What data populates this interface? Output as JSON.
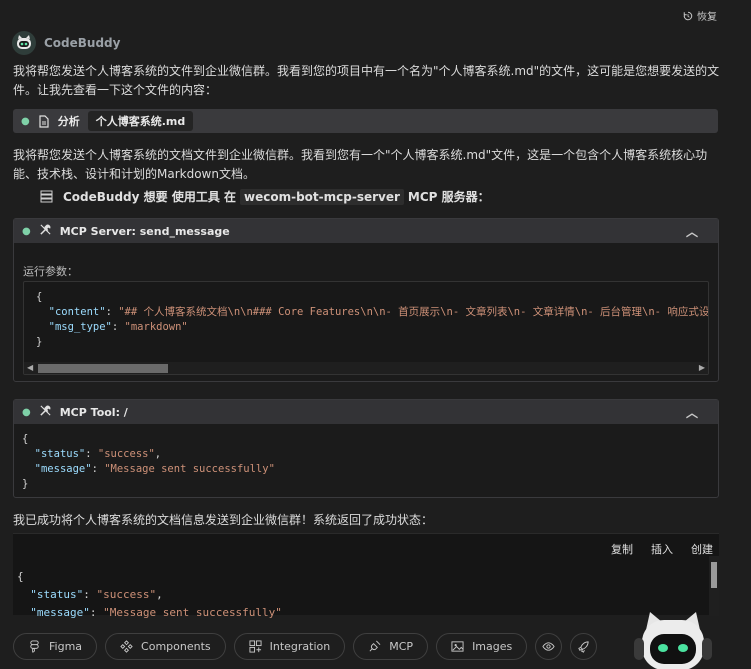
{
  "window": {
    "restore_label": "恢复"
  },
  "header": {
    "name": "CodeBuddy"
  },
  "messages": {
    "intro": "我将帮您发送个人博客系统的文件到企业微信群。我看到您的项目中有一个名为\"个人博客系统.md\"的文件，这可能是您想要发送的文件。让我先查看一下这个文件的内容：",
    "analysis_label": "分析",
    "analysis_file": "个人博客系统.md",
    "summary": "我将帮您发送个人博客系统的文档文件到企业微信群。我看到您有一个\"个人博客系统.md\"文件，这是一个包含个人博客系统核心功能、技术栈、设计和计划的Markdown文档。",
    "mcp_request_prefix": "CodeBuddy 想要 使用工具 在",
    "mcp_server_name": "wecom-bot-mcp-server",
    "mcp_request_suffix": "MCP 服务器：",
    "final": "我已成功将个人博客系统的文档信息发送到企业微信群！系统返回了成功状态："
  },
  "panel_send": {
    "title": "MCP Server: send_message",
    "params_label": "运行参数：",
    "code": {
      "open": "{",
      "content_key": "\"content\"",
      "content_value": "\"## 个人博客系统文档\\n\\n### Core Features\\n\\n- 首页展示\\n- 文章列表\\n- 文章详情\\n- 后台管理\\n- 响应式设",
      "msg_type_key": "\"msg_type\"",
      "msg_type_value": "\"markdown\"",
      "close": "}"
    }
  },
  "panel_tool": {
    "title": "MCP Tool: /",
    "code": {
      "open": "{",
      "status_key": "\"status\"",
      "status_value": "\"success\"",
      "message_key": "\"message\"",
      "message_value": "\"Message sent successfully\"",
      "close": "}"
    }
  },
  "result": {
    "actions": [
      "复制",
      "插入",
      "创建"
    ],
    "code": {
      "open": "{",
      "status_key": "\"status\"",
      "status_value": "\"success\"",
      "message_key": "\"message\"",
      "message_value": "\"Message sent successfully\""
    }
  },
  "toolbar": {
    "figma": "Figma",
    "components": "Components",
    "integration": "Integration",
    "mcp": "MCP",
    "images": "Images"
  },
  "colors": {
    "accent_green": "#7fd1a8",
    "json_key": "#9cdcfe",
    "json_string": "#ce9178"
  }
}
